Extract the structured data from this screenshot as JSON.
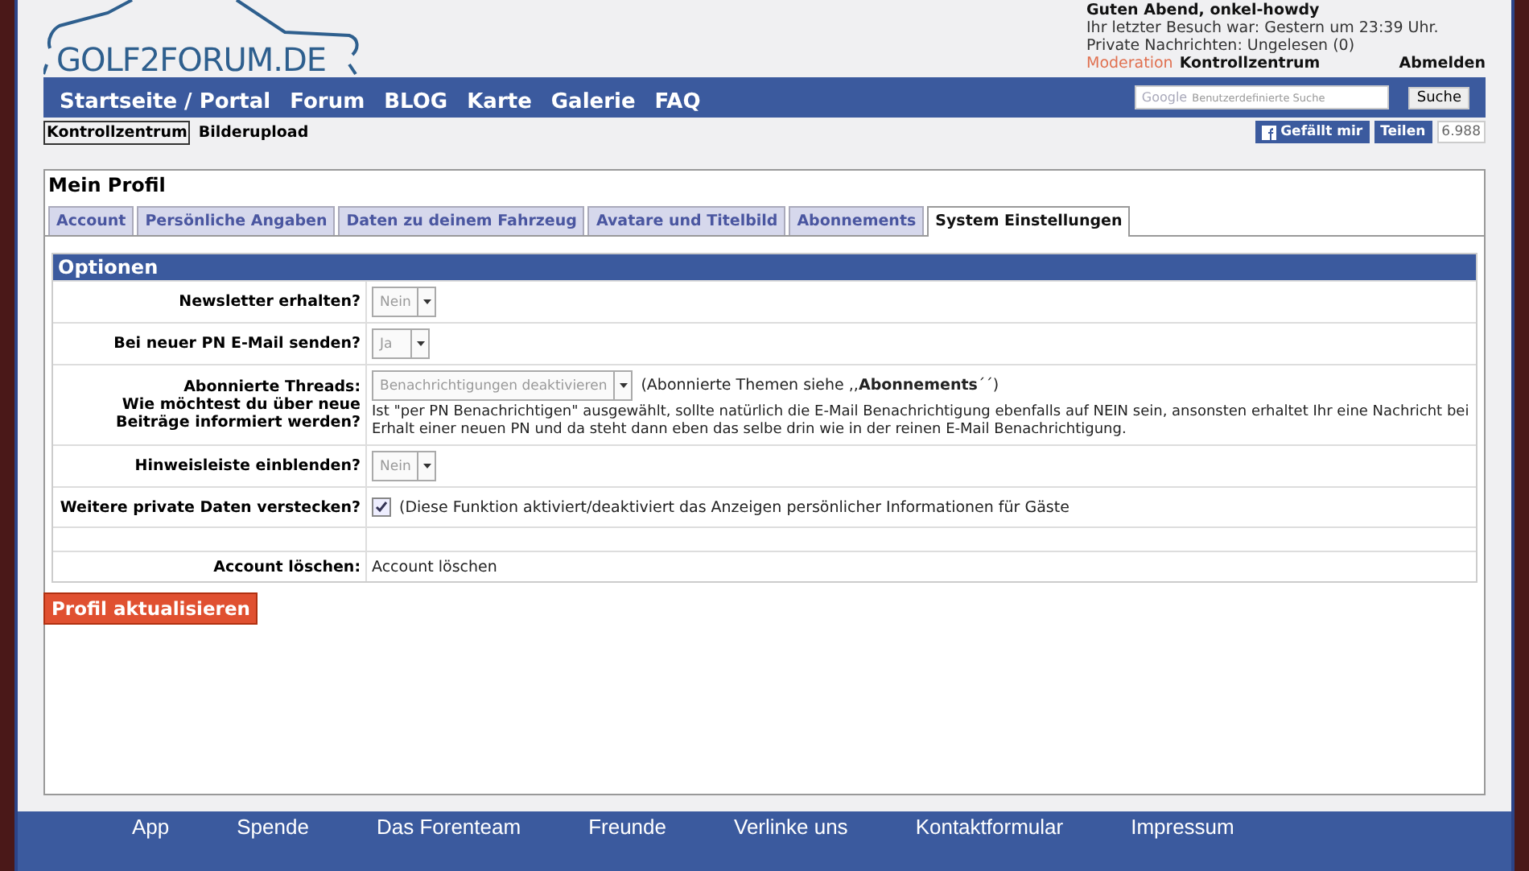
{
  "logo": {
    "text": "GOLF2FORUM.DE"
  },
  "user_box": {
    "greeting": "Guten Abend, onkel-howdy",
    "last_visit": "Ihr letzter Besuch war: Gestern um 23:39 Uhr.",
    "messages": "Private Nachrichten: Ungelesen (0)",
    "moderation": "Moderation",
    "control_center": "Kontrollzentrum",
    "logout": "Abmelden"
  },
  "nav": [
    "Startseite / Portal",
    "Forum",
    "BLOG",
    "Karte",
    "Galerie",
    "FAQ"
  ],
  "search": {
    "placeholder": "Benutzerdefinierte Suche",
    "brand": "Google",
    "button": "Suche"
  },
  "subnav": [
    {
      "label": "Kontrollzentrum",
      "selected": true
    },
    {
      "label": "Bilderupload",
      "selected": false
    }
  ],
  "social": {
    "like": "Gefällt mir",
    "share": "Teilen",
    "count": "6.988"
  },
  "profile": {
    "title": "Mein Profil",
    "tabs": [
      {
        "label": "Account",
        "selected": false
      },
      {
        "label": "Persönliche Angaben",
        "selected": false
      },
      {
        "label": "Daten zu deinem Fahrzeug",
        "selected": false
      },
      {
        "label": "Avatare und Titelbild",
        "selected": false
      },
      {
        "label": "Abonnements",
        "selected": false
      },
      {
        "label": "System Einstellungen",
        "selected": true
      }
    ],
    "section": "Optionen",
    "rows": [
      {
        "kind": "select",
        "label": "Newsletter erhalten?",
        "value": "Nein"
      },
      {
        "kind": "select",
        "label": "Bei neuer PN E-Mail senden?",
        "value": "Ja"
      },
      {
        "kind": "select_note",
        "label": "Abonnierte Threads:",
        "sublabel": "Wie möchtest du über neue Beiträge informiert werden?",
        "value": "Benachrichtigungen deaktivieren",
        "note": "(Abonnierte Themen siehe ,,**Abonnements**´´)",
        "description": "Ist \"per PN Benachrichtigen\" ausgewählt, sollte natürlich die E-Mail Benachrichtigung ebenfalls auf NEIN sein, ansonsten erhaltet Ihr eine Nachricht bei Erhalt einer neuen PN und da steht dann eben das selbe drin wie in der reinen E-Mail Benachrichtigung."
      },
      {
        "kind": "select",
        "label": "Hinweisleiste einblenden?",
        "value": "Nein"
      },
      {
        "kind": "checkbox",
        "label": "Weitere private Daten verstecken?",
        "checked": true,
        "note": "(Diese Funktion aktiviert/deaktiviert das Anzeigen persönlicher Informationen für Gäste"
      },
      {
        "kind": "empty"
      },
      {
        "kind": "text",
        "label": "Account löschen:",
        "value": "Account löschen"
      }
    ],
    "submit": "Profil aktualisieren"
  },
  "footer": [
    "App",
    "Spende",
    "Das Forenteam",
    "Freunde",
    "Verlinke uns",
    "Kontaktformular",
    "Impressum"
  ]
}
